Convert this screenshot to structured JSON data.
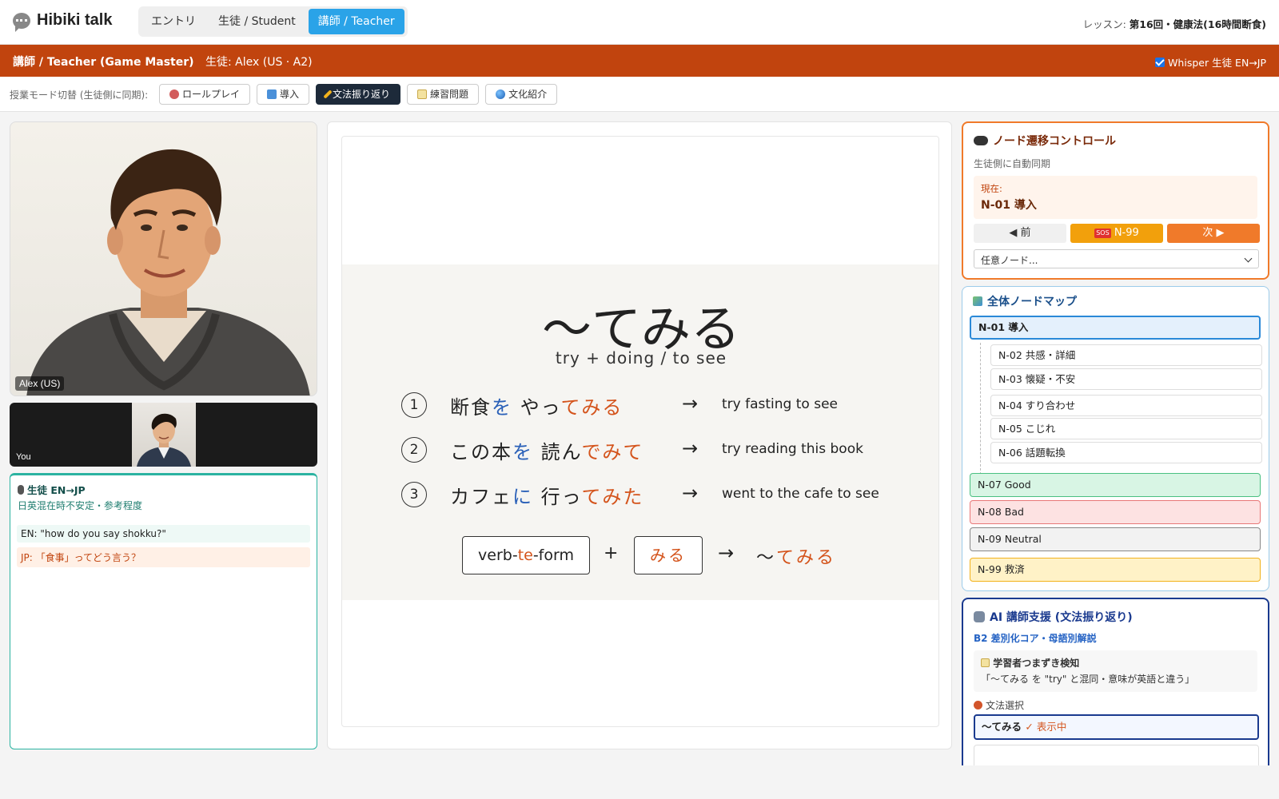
{
  "app": {
    "name": "Hibiki talk"
  },
  "nav": {
    "tabs": [
      {
        "label": "エントリ"
      },
      {
        "label": "生徒 / Student"
      },
      {
        "label": "講師 / Teacher",
        "active": true
      }
    ],
    "lesson_label": "レッスン:",
    "lesson_value": "第16回・健康法(16時間断食)"
  },
  "role_bar": {
    "title": "講師 / Teacher (Game Master)",
    "student": "生徒: Alex (US · A2)",
    "whisper_label": "Whisper 生徒 EN→JP",
    "whisper_checked": true
  },
  "class_mode": {
    "label": "授業モード切替 (生徒側に同期):",
    "buttons": [
      {
        "label": "ロールプレイ",
        "icon": "theater-masks-icon"
      },
      {
        "label": "導入",
        "icon": "book-icon"
      },
      {
        "label": "文法振り返り",
        "icon": "pencil-icon",
        "active": true
      },
      {
        "label": "練習問題",
        "icon": "memo-icon"
      },
      {
        "label": "文化紹介",
        "icon": "globe-icon"
      }
    ]
  },
  "video": {
    "main_label": "Alex (US)",
    "self_label": "You"
  },
  "stt": {
    "title": "生徒 EN→JP",
    "subtitle": "日英混在時不安定・参考程度",
    "en_line": "EN: \"how do you say shokku?\"",
    "jp_line": "JP: 「食事」ってどう言う？"
  },
  "slide": {
    "title": "〜てみる",
    "subtitle": "try + doing / to see",
    "examples": [
      {
        "num": "1",
        "jp_a": "断食",
        "jp_particle": "を",
        "jp_b": " やっ",
        "jp_grammar": "てみる",
        "arrow": "→",
        "en": "try fasting to see"
      },
      {
        "num": "2",
        "jp_a": "この本",
        "jp_particle": "を",
        "jp_b": " 読ん",
        "jp_grammar": "でみて",
        "arrow": "→",
        "en": "try reading this book"
      },
      {
        "num": "3",
        "jp_a": "カフェ",
        "jp_particle": "に",
        "jp_b": " 行っ",
        "jp_grammar": "てみた",
        "arrow": "→",
        "en": "went to the cafe to see"
      }
    ],
    "formula": {
      "box1_pre": "verb-",
      "box1_te": "te",
      "box1_post": "-form",
      "plus": "+",
      "box2": "みる",
      "arrow": "→",
      "result_tilde": "〜",
      "result_grammar": "てみる"
    }
  },
  "node_control": {
    "title": "ノード遷移コントロール",
    "sync": "生徒側に自動同期",
    "current_label": "現在:",
    "current_value": "N-01 導入",
    "prev": "◀ 前",
    "sos_tag": "SOS",
    "sos": "N-99",
    "next": "次 ▶",
    "select_placeholder": "任意ノード..."
  },
  "node_map": {
    "title": "全体ノードマップ",
    "active": "N-01 導入",
    "subs": [
      "N-02 共感・詳細",
      "N-03 懐疑・不安",
      "N-04 すり合わせ",
      "N-05 こじれ",
      "N-06 話題転換"
    ],
    "good": "N-07 Good",
    "bad": "N-08 Bad",
    "neutral": "N-09 Neutral",
    "rescue": "N-99 救済"
  },
  "ai": {
    "title": "AI 講師支援 (文法振り返り)",
    "subtitle": "B2 差別化コア・母語別解説",
    "card_head": "学習者つまずき検知",
    "card_text": "「〜てみる を \"try\" と混同・意味が英語と違う」",
    "select_label": "文法選択",
    "option": "〜てみる",
    "option_state": "✓ 表示中"
  },
  "colors": {
    "accent_orange": "#c1440e",
    "teacher_tab": "#2aa3e8",
    "grammar_highlight": "#d4541c",
    "particle_blue": "#2a60b8",
    "ai_navy": "#1a3a8f"
  }
}
